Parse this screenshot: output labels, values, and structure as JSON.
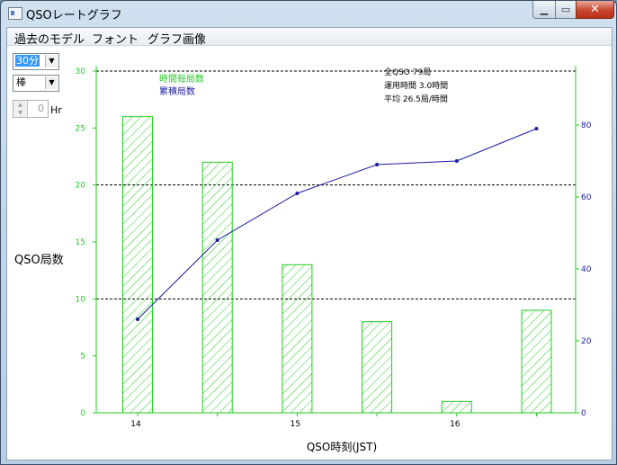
{
  "window": {
    "title": "QSOレートグラフ",
    "minimize_glyph": "▁",
    "maximize_glyph": "▭",
    "close_glyph": "✕"
  },
  "menu": {
    "items": [
      "過去のモデル",
      "フォント",
      "グラフ画像"
    ]
  },
  "controls": {
    "interval": {
      "value": "30分"
    },
    "style": {
      "value": "棒"
    },
    "hours": {
      "value": "0",
      "unit": "Hr"
    }
  },
  "colors": {
    "bar": "#22cc22",
    "line": "#1a1aa0",
    "axis": "#22cc22",
    "grid": "#000000",
    "text": "#000000"
  },
  "chart_data": {
    "type": "bar",
    "title": "",
    "xlabel": "QSO時刻(JST)",
    "ylabel": "QSO局数",
    "ylim": [
      0,
      30
    ],
    "y2lim": [
      0,
      95
    ],
    "yticks": [
      0,
      5,
      10,
      15,
      20,
      25,
      30
    ],
    "y2ticks": [
      0,
      20,
      40,
      60,
      80
    ],
    "x_tick_labels": [
      {
        "index": 0,
        "label": "14"
      },
      {
        "index": 2,
        "label": "15"
      },
      {
        "index": 4,
        "label": "16"
      }
    ],
    "dashed_gridlines_at": [
      10,
      20,
      30
    ],
    "legend": {
      "position": "top-left",
      "entries": [
        {
          "name": "時間毎局数",
          "color": "#22cc22"
        },
        {
          "name": "累積局数",
          "color": "#1a1aa0"
        }
      ]
    },
    "summary": [
      "全QSO 79局",
      "運用時間 3.0時間",
      "平均 26.5局/時間"
    ],
    "series": [
      {
        "name": "時間毎局数",
        "type": "bar",
        "values": [
          26,
          22,
          13,
          8,
          1,
          9
        ]
      },
      {
        "name": "累積局数",
        "type": "line",
        "axis": "right",
        "values": [
          26,
          48,
          61,
          69,
          70,
          79
        ]
      }
    ]
  }
}
